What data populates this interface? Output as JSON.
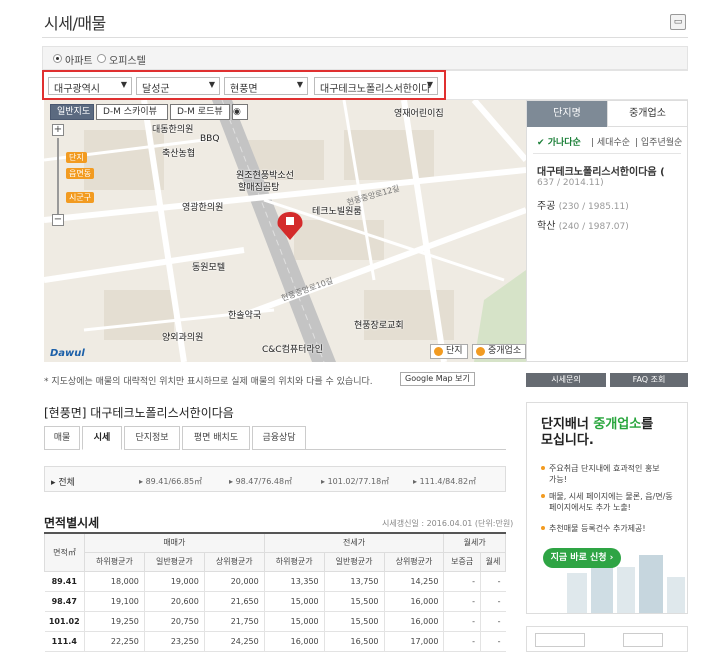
{
  "header": {
    "title": "시세/매물",
    "print_icon": "printer-icon"
  },
  "type_filter": [
    {
      "label": "아파트",
      "selected": true
    },
    {
      "label": "오피스텔",
      "selected": false
    }
  ],
  "selects": [
    {
      "label": "대구광역시"
    },
    {
      "label": "달성군"
    },
    {
      "label": "현풍면"
    },
    {
      "label": "대구테크노폴리스서한이다"
    }
  ],
  "map": {
    "tabs": [
      "일반지도",
      "D-M 스카이뷰",
      "D-M 로드뷰"
    ],
    "zoom_labels": [
      "단지",
      "읍면동",
      "시군구"
    ],
    "pois": [
      "영재어린이집",
      "대동한의원",
      "BBQ",
      "축산농협",
      "원조현풍박소선",
      "할매집곰탕",
      "영광한의원",
      "테크노빌원룸",
      "동원모텔",
      "한솔약국",
      "양외과의원",
      "현풍장로교회",
      "C&C컴퓨터라인"
    ],
    "roads": [
      "현풍중앙로12길",
      "현풍중앙로10길"
    ],
    "logo": "Dawul",
    "legend": [
      "단지",
      "중개업소"
    ]
  },
  "side_panel": {
    "tabs": [
      "단지명",
      "중개업소"
    ],
    "sort": [
      "가나다순",
      "세대수순",
      "입주년월순"
    ],
    "items": [
      {
        "name": "대구테크노폴리스서한이다음",
        "meta": "637 / 2014.11"
      },
      {
        "name": "주공",
        "meta": "230 / 1985.11"
      },
      {
        "name": "학산",
        "meta": "240 / 1987.07"
      }
    ],
    "buttons": [
      "시세문의",
      "FAQ 조회"
    ]
  },
  "note": {
    "text": "* 지도상에는 매물의 대략적인 위치만 표시하므로 실제 매물의 위치와 다를 수 있습니다.",
    "gmap_label": "Google Map 보기"
  },
  "complex": {
    "title": "[현풍면] 대구테크노폴리스서한이다음",
    "tabs": [
      "매물",
      "시세",
      "단지정보",
      "평면 배치도",
      "금융상담"
    ],
    "area_filter": [
      "전체",
      "89.41/66.85㎡",
      "98.47/76.48㎡",
      "101.02/77.18㎡",
      "111.4/84.82㎡"
    ]
  },
  "price_table": {
    "title": "면적별시세",
    "date": "시세갱신일 : 2016.04.01 (단위:만원)",
    "col_area": "면적㎡",
    "groups": [
      "매매가",
      "전세가",
      "월세가"
    ],
    "subcols": [
      "하위평균가",
      "일반평균가",
      "상위평균가",
      "하위평균가",
      "일반평균가",
      "상위평균가",
      "보증금",
      "월세"
    ],
    "rows": [
      {
        "area": "89.41",
        "vals": [
          "18,000",
          "19,000",
          "20,000",
          "13,350",
          "13,750",
          "14,250",
          "-",
          "-"
        ]
      },
      {
        "area": "98.47",
        "vals": [
          "19,100",
          "20,600",
          "21,650",
          "15,000",
          "15,500",
          "16,000",
          "-",
          "-"
        ]
      },
      {
        "area": "101.02",
        "vals": [
          "19,250",
          "20,750",
          "21,750",
          "15,000",
          "15,500",
          "16,000",
          "-",
          "-"
        ]
      },
      {
        "area": "111.4",
        "vals": [
          "22,250",
          "23,250",
          "24,250",
          "16,000",
          "16,500",
          "17,000",
          "-",
          "-"
        ]
      }
    ]
  },
  "ad": {
    "line1_a": "단지배너 ",
    "line1_b": "중개업소",
    "line1_c": "를",
    "line2": "모십니다.",
    "bullets": [
      "주요취급 단지내에 효과적인 홍보 가능!",
      "매물, 시세 페이지에는 물론, 읍/면/동 페이지에서도 추가 노출!",
      "추천매물 등록건수 추가제공!"
    ],
    "button": "지금 바로 신청 ›"
  }
}
